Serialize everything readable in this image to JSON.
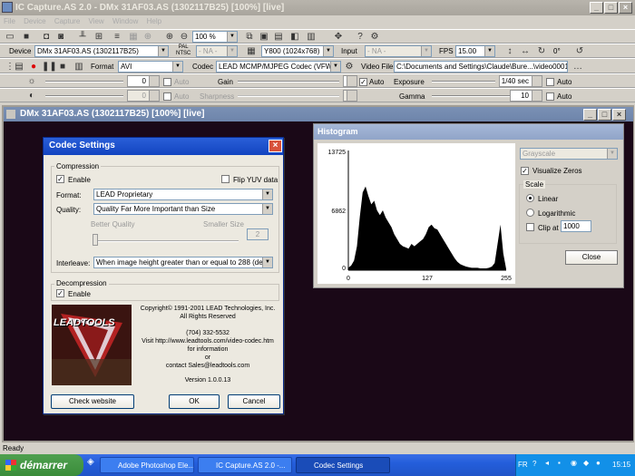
{
  "app": {
    "title": "IC Capture.AS 2.0 - DMx 31AF03.AS (1302117B25) [100%] [live]"
  },
  "menu": [
    "File",
    "Device",
    "Capture",
    "View",
    "Window",
    "Help"
  ],
  "toolbar1": {
    "zoom": "100 %",
    "format_val": "Y800 (1024x768)",
    "input_label": "Input",
    "input_val": "- NA -",
    "fps_label": "FPS",
    "fps_val": "15.00",
    "pal_top": "PAL",
    "pal_bottom": "NTSC",
    "na": "- NA -",
    "rot": "0°"
  },
  "toolbar2": {
    "device_label": "Device",
    "device_val": "DMx 31AF03.AS (1302117B25)",
    "format_label": "Format",
    "format_val": "AVI",
    "codec_label": "Codec",
    "codec_val": "LEAD MCMP/MJPEG Codec (VFW)",
    "videofile_label": "Video File",
    "videofile_val": "C:\\Documents and Settings\\Claude\\Bure...\\video0001.avi"
  },
  "toolbar3": {
    "v1": "0",
    "auto": "Auto",
    "gain_label": "Gain",
    "auto2": "Auto",
    "exposure_label": "Exposure",
    "exposure_val": "1/40 sec",
    "auto3": "Auto"
  },
  "toolbar4": {
    "v1": "0",
    "auto": "Auto",
    "sharpness_label": "Sharpness",
    "gamma_label": "Gamma",
    "gamma_val": "10",
    "auto3": "Auto"
  },
  "child": {
    "title": "DMx 31AF03.AS (1302117B25) [100%] [live]"
  },
  "codec": {
    "title": "Codec Settings",
    "compression": "Compression",
    "enable": "Enable",
    "flip": "Flip YUV data",
    "format_label": "Format:",
    "format_val": "LEAD Proprietary",
    "quality_label": "Quality:",
    "quality_val": "Quality Far More Important than Size",
    "better": "Better Quality",
    "smaller": "Smaller Size",
    "size_val": "2",
    "interleave_label": "Interleave:",
    "interleave_val": "When image height greater than or equal to 288 (default)",
    "decompression": "Decompression",
    "enable2": "Enable",
    "logo": "LEADTOOLS",
    "copyright1": "Copyright© 1991-2001 LEAD Technologies, Inc.",
    "copyright2": "All Rights Reserved",
    "phone": "(704) 332-5532",
    "visit": "Visit http://www.leadtools.com/video-codec.htm",
    "forinfo": "for information",
    "or": "or",
    "contact": "contact Sales@leadtools.com",
    "version": "Version 1.0.0.13",
    "check": "Check website",
    "ok": "OK",
    "cancel": "Cancel"
  },
  "histogram": {
    "title": "Histogram",
    "ymax": "13725",
    "ymid": "6862",
    "ymin": "0",
    "x0": "0",
    "x1": "127",
    "x2": "255",
    "mode": "Grayscale",
    "visualize": "Visualize Zeros",
    "scale": "Scale",
    "linear": "Linear",
    "log": "Logarithmic",
    "clip": "Clip at",
    "clip_val": "1000",
    "close": "Close",
    "bins": [
      0.02,
      0.04,
      0.08,
      0.2,
      0.45,
      0.65,
      0.7,
      0.62,
      0.55,
      0.58,
      0.5,
      0.46,
      0.5,
      0.44,
      0.4,
      0.36,
      0.3,
      0.26,
      0.22,
      0.2,
      0.19,
      0.18,
      0.22,
      0.2,
      0.22,
      0.24,
      0.26,
      0.3,
      0.36,
      0.38,
      0.35,
      0.34,
      0.3,
      0.26,
      0.22,
      0.18,
      0.14,
      0.1,
      0.07,
      0.05,
      0.04,
      0.03,
      0.025,
      0.02,
      0.02,
      0.02,
      0.015,
      0.015,
      0.015,
      0.02,
      0.03,
      0.06,
      0.22,
      0.38,
      0.14,
      0.01
    ]
  },
  "status": {
    "text": "Ready"
  },
  "taskbar": {
    "start": "démarrer",
    "t1": "Adobe Photoshop Ele...",
    "t2": "IC Capture.AS 2.0 -...",
    "t3": "Codec Settings",
    "lang": "FR",
    "clock": "15:15"
  }
}
